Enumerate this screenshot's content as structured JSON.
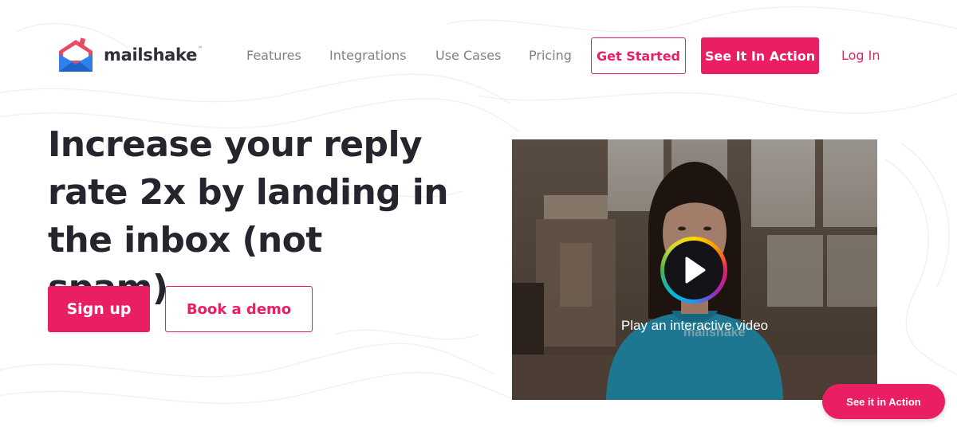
{
  "brand": {
    "name": "mailshake",
    "trademark": "™",
    "colors": {
      "primary": "#e91e63",
      "logo_blue": "#2f80ed",
      "logo_red": "#e84a5f"
    }
  },
  "nav": {
    "items": [
      {
        "label": "Features"
      },
      {
        "label": "Integrations"
      },
      {
        "label": "Use Cases"
      },
      {
        "label": "Pricing"
      }
    ],
    "get_started_label": "Get Started",
    "see_in_action_label": "See It In Action",
    "login_label": "Log In"
  },
  "hero": {
    "headline_lines": [
      "Increase your reply",
      "rate 2x by landing in",
      "the inbox (not spam)."
    ],
    "signup_label": "Sign up",
    "demo_label": "Book a demo"
  },
  "video": {
    "caption": "Play an interactive video",
    "shirt_text": "mailshake",
    "play_icon": "play-icon"
  },
  "floating": {
    "label": "See it in Action"
  }
}
